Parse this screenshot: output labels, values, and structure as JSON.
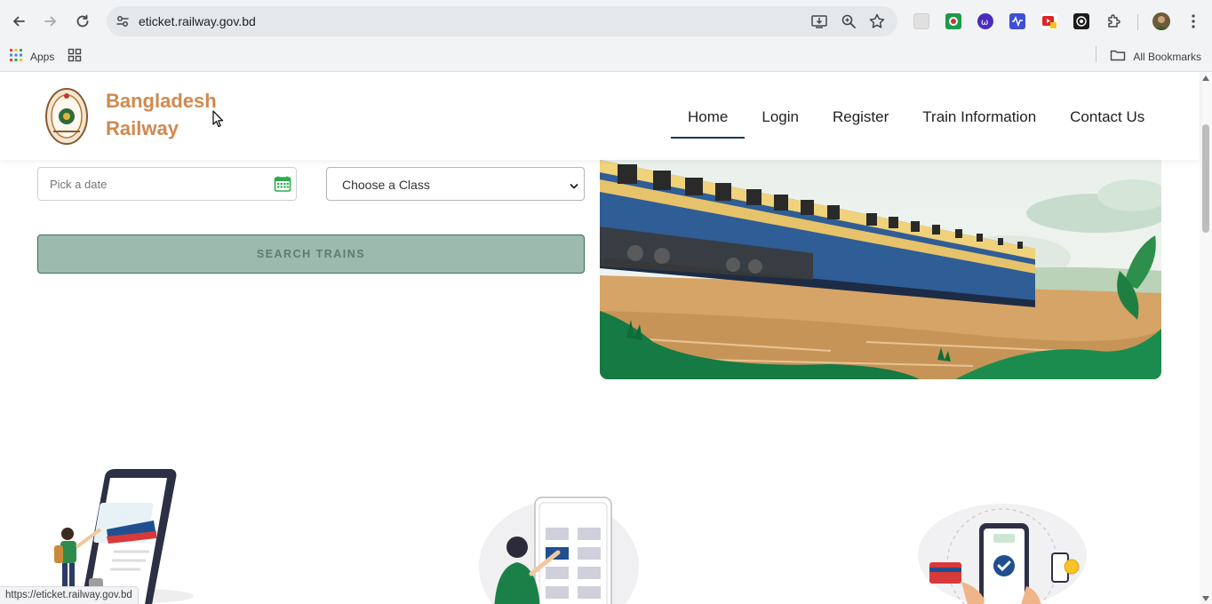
{
  "browser": {
    "url": "eticket.railway.gov.bd",
    "bookmarks": {
      "apps_label": "Apps",
      "all_bookmarks_label": "All Bookmarks"
    },
    "status_url": "https://eticket.railway.gov.bd"
  },
  "site": {
    "brand_line1": "Bangladesh",
    "brand_line2": "Railway",
    "brand_color": "#d0894f",
    "nav": [
      {
        "label": "Home",
        "active": true
      },
      {
        "label": "Login",
        "active": false
      },
      {
        "label": "Register",
        "active": false
      },
      {
        "label": "Train Information",
        "active": false
      },
      {
        "label": "Contact Us",
        "active": false
      }
    ]
  },
  "search_form": {
    "date_placeholder": "Pick a date",
    "class_select_value": "Choose a Class",
    "search_button_label": "SEARCH TRAINS",
    "calendar_icon": "calendar-icon",
    "button_color": "#9cbaae"
  },
  "icons": {
    "back": "back-arrow-icon",
    "forward": "forward-arrow-icon",
    "reload": "reload-icon",
    "site_info": "site-info-icon",
    "install": "install-app-icon",
    "zoom": "zoom-icon",
    "bookmark": "star-icon",
    "extensions": "puzzle-icon",
    "menu": "kebab-menu-icon"
  }
}
